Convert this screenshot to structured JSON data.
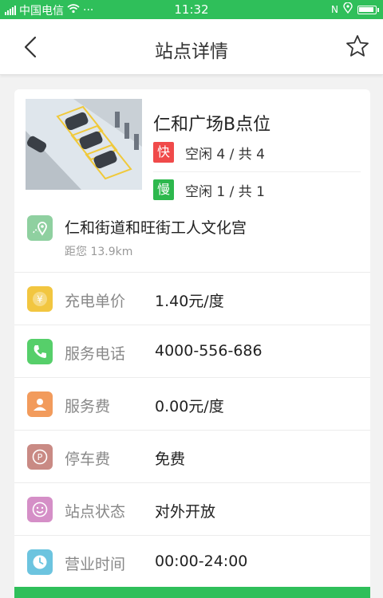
{
  "status_bar": {
    "carrier": "中国电信",
    "time": "11:32",
    "dots": "···",
    "nfc": "N"
  },
  "header": {
    "title": "站点详情"
  },
  "station": {
    "name": "仁和广场B点位",
    "fast": {
      "tag": "快",
      "text": "空闲 4 / 共 4",
      "color": "#f04a4a"
    },
    "slow": {
      "tag": "慢",
      "text": "空闲 1 / 共 1",
      "color": "#2db84d"
    }
  },
  "address": {
    "text": "仁和街道和旺街工人文化宫",
    "distance": "距您 13.9km",
    "icon": "map-pin-icon",
    "icon_color": "#8fd0a0"
  },
  "details": [
    {
      "key": "price",
      "label": "充电单价",
      "value": "1.40元/度",
      "icon": "yuan-icon",
      "color": "#f2c640",
      "glyph": "¥"
    },
    {
      "key": "phone",
      "label": "服务电话",
      "value": "4000-556-686",
      "icon": "phone-icon",
      "color": "#56cf6a",
      "glyph": ""
    },
    {
      "key": "service-fee",
      "label": "服务费",
      "value": "0.00元/度",
      "icon": "person-icon",
      "color": "#f29b5c",
      "glyph": ""
    },
    {
      "key": "parking",
      "label": "停车费",
      "value": "免费",
      "icon": "parking-icon",
      "color": "#c98a84",
      "glyph": "P"
    },
    {
      "key": "station-status",
      "label": "站点状态",
      "value": "对外开放",
      "icon": "smile-icon",
      "color": "#d58fc7",
      "glyph": "☺"
    },
    {
      "key": "hours",
      "label": "营业时间",
      "value": "00:00-24:00",
      "icon": "clock-icon",
      "color": "#6cc4df",
      "glyph": ""
    }
  ],
  "colors": {
    "brand_green": "#2fbf5a"
  }
}
